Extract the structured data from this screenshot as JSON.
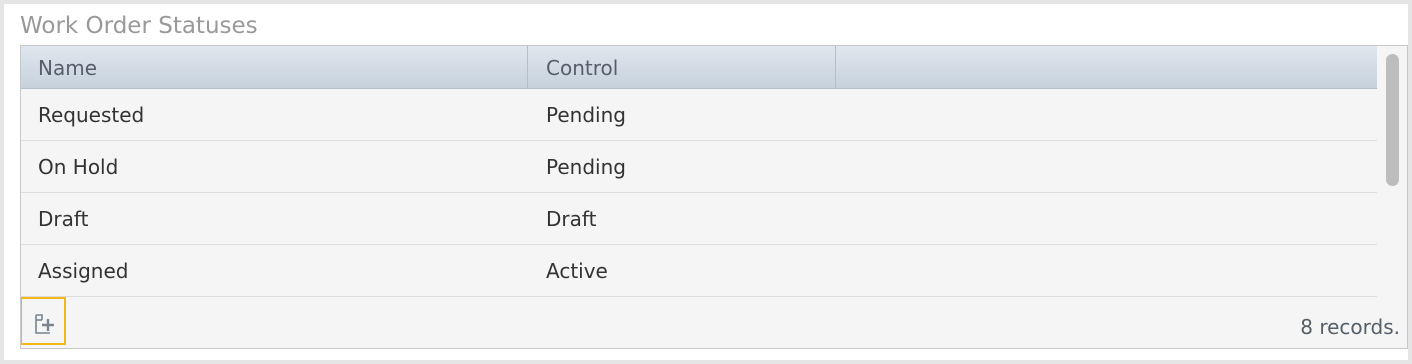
{
  "panel": {
    "title": "Work Order Statuses"
  },
  "grid": {
    "columns": [
      "Name",
      "Control",
      ""
    ],
    "rows": [
      {
        "name": "Requested",
        "control": "Pending"
      },
      {
        "name": "On Hold",
        "control": "Pending"
      },
      {
        "name": "Draft",
        "control": "Draft"
      },
      {
        "name": "Assigned",
        "control": "Active"
      }
    ]
  },
  "footer": {
    "add_icon": "add-document-icon",
    "records_text": "8 records."
  },
  "colors": {
    "header_gradient_top": "#dfe6ee",
    "header_gradient_bottom": "#c7d2dd",
    "focus_outline": "#f4b719",
    "row_background": "#f5f5f5"
  }
}
